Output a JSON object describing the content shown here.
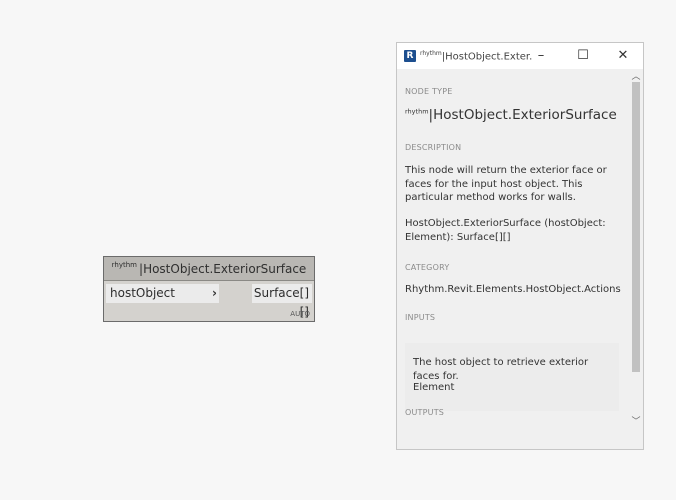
{
  "node": {
    "prefix": "rhythm",
    "title": "HostObject.ExteriorSurface",
    "input_port": "hostObject",
    "output_port": "Surface[][]",
    "lacing": "AUTO"
  },
  "window": {
    "prefix": "rhythm",
    "title": "HostObject.Exter...",
    "node_type_label": "NODE TYPE",
    "node_type_prefix": "rhythm",
    "node_type": "HostObject.ExteriorSurface",
    "description_label": "DESCRIPTION",
    "description": "This node will return the exterior face or faces for the input host object. This particular method works for walls.",
    "signature": "HostObject.ExteriorSurface (hostObject: Element): Surface[][]",
    "category_label": "CATEGORY",
    "category": "Rhythm.Revit.Elements.HostObject.Actions",
    "inputs_label": "INPUTS",
    "input_description": "The host object to retrieve exterior faces for.",
    "input_type": "Element",
    "outputs_label": "OUTPUTS"
  }
}
